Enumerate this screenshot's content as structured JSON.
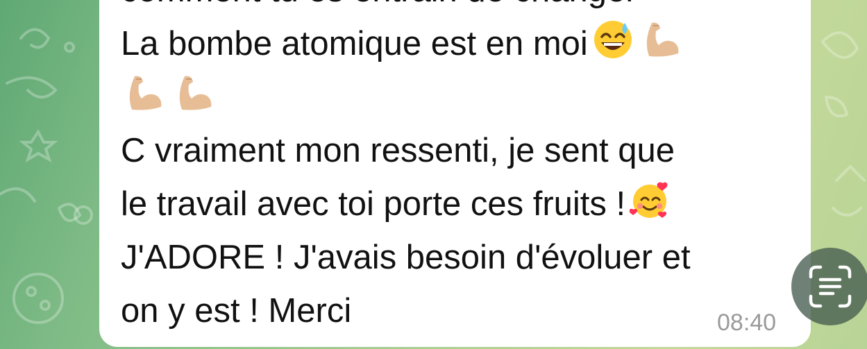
{
  "message": {
    "lines": [
      "comment tu es entrain de changer",
      "La bombe atomique est en moi",
      "",
      "C vraiment mon ressenti, je sent que",
      "le travail avec toi porte ces fruits !",
      "J'ADORE ! J'avais besoin d'évoluer et",
      "on y est ! Merci"
    ],
    "emojis": {
      "sweat_smile": "grinning-sweat-emoji",
      "flexed_biceps": "flexed-biceps-emoji",
      "hearts_face": "smiling-face-with-hearts-emoji"
    },
    "time": "08:40"
  },
  "scan_button": {
    "icon": "live-text-scan-icon"
  },
  "colors": {
    "bubble": "#ffffff",
    "text": "#111111",
    "timestamp": "#9a9a9a",
    "wallpaper_start": "#5fa874",
    "wallpaper_end": "#c3d99a"
  }
}
